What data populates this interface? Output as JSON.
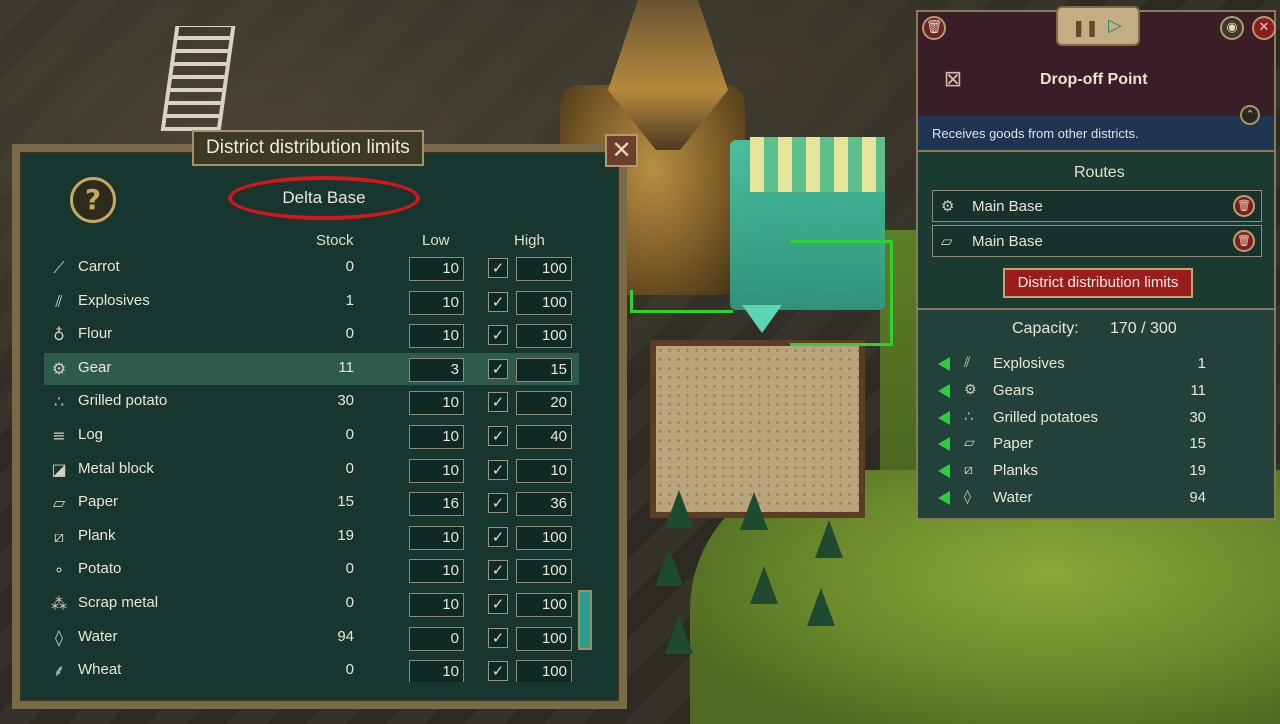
{
  "district_panel": {
    "title": "District distribution limits",
    "help": "?",
    "close": "✕",
    "district_name": "Delta Base",
    "columns": {
      "stock": "Stock",
      "low": "Low",
      "high": "High"
    },
    "rows": [
      {
        "name": "Carrot",
        "icon": "carrot-icon",
        "glyph": "⟋",
        "stock": "0",
        "low": "10",
        "high": "100",
        "checked": true
      },
      {
        "name": "Explosives",
        "icon": "explosives-icon",
        "glyph": "⫽",
        "stock": "1",
        "low": "10",
        "high": "100",
        "checked": true
      },
      {
        "name": "Flour",
        "icon": "flour-icon",
        "glyph": "♁",
        "stock": "0",
        "low": "10",
        "high": "100",
        "checked": true
      },
      {
        "name": "Gear",
        "icon": "gear-icon",
        "glyph": "⚙",
        "stock": "11",
        "low": "3",
        "high": "15",
        "checked": true,
        "selected": true
      },
      {
        "name": "Grilled potato",
        "icon": "grilled-potato-icon",
        "glyph": "∴",
        "stock": "30",
        "low": "10",
        "high": "20",
        "checked": true
      },
      {
        "name": "Log",
        "icon": "log-icon",
        "glyph": "≡",
        "stock": "0",
        "low": "10",
        "high": "40",
        "checked": true
      },
      {
        "name": "Metal block",
        "icon": "metal-block-icon",
        "glyph": "◪",
        "stock": "0",
        "low": "10",
        "high": "10",
        "checked": true
      },
      {
        "name": "Paper",
        "icon": "paper-icon",
        "glyph": "▱",
        "stock": "15",
        "low": "16",
        "high": "36",
        "checked": true
      },
      {
        "name": "Plank",
        "icon": "plank-icon",
        "glyph": "⧄",
        "stock": "19",
        "low": "10",
        "high": "100",
        "checked": true
      },
      {
        "name": "Potato",
        "icon": "potato-icon",
        "glyph": "∘",
        "stock": "0",
        "low": "10",
        "high": "100",
        "checked": true
      },
      {
        "name": "Scrap metal",
        "icon": "scrap-metal-icon",
        "glyph": "⁂",
        "stock": "0",
        "low": "10",
        "high": "100",
        "checked": true
      },
      {
        "name": "Water",
        "icon": "water-drop-icon",
        "glyph": "◊",
        "stock": "94",
        "low": "0",
        "high": "100",
        "checked": true
      },
      {
        "name": "Wheat",
        "icon": "wheat-icon",
        "glyph": "⸙",
        "stock": "0",
        "low": "10",
        "high": "100",
        "checked": true
      }
    ],
    "checkmark": "✓"
  },
  "building_panel": {
    "title": "Drop-off Point",
    "description": "Receives goods from other districts.",
    "routes_heading": "Routes",
    "routes": [
      {
        "label": "Main Base",
        "icon": "gear-icon",
        "glyph": "⚙"
      },
      {
        "label": "Main Base",
        "icon": "paper-icon",
        "glyph": "▱"
      }
    ],
    "limits_button": "District distribution limits",
    "capacity_label": "Capacity:",
    "capacity_value": "170  /  300",
    "inventory": [
      {
        "name": "Explosives",
        "icon": "explosives-icon",
        "glyph": "⫽",
        "value": "1"
      },
      {
        "name": "Gears",
        "icon": "gear-icon",
        "glyph": "⚙",
        "value": "11"
      },
      {
        "name": "Grilled potatoes",
        "icon": "grilled-potato-icon",
        "glyph": "∴",
        "value": "30"
      },
      {
        "name": "Paper",
        "icon": "paper-icon",
        "glyph": "▱",
        "value": "15"
      },
      {
        "name": "Planks",
        "icon": "plank-icon",
        "glyph": "⧄",
        "value": "19"
      },
      {
        "name": "Water",
        "icon": "water-drop-icon",
        "glyph": "◊",
        "value": "94"
      }
    ],
    "icons": {
      "delete": "🗑",
      "pause": "❚❚",
      "play": "▷",
      "eye": "◉",
      "close": "✕",
      "building": "⊠",
      "collapse": "⌃",
      "route_delete": "🗑"
    }
  },
  "colors": {
    "district_bg": "#17362f",
    "frame": "#7a6a45",
    "highlight_ellipse": "#d3161a",
    "limits_button": "#9a1d1e",
    "route_line": "#2fd12f"
  }
}
